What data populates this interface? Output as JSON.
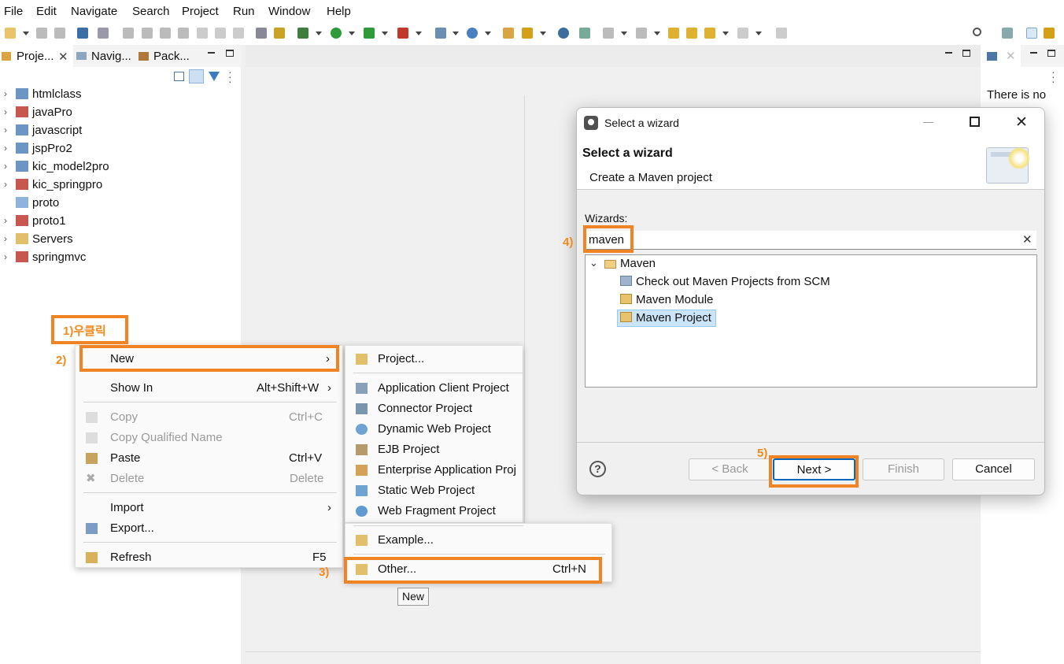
{
  "menubar": [
    "File",
    "Edit",
    "Navigate",
    "Search",
    "Project",
    "Run",
    "Window",
    "Help"
  ],
  "left_tabs": {
    "project": "Proje...",
    "navigator": "Navig...",
    "package": "Pack..."
  },
  "tree": [
    "htmlclass",
    "javaPro",
    "javascript",
    "jspPro2",
    "kic_model2pro",
    "kic_springpro",
    "proto",
    "proto1",
    "Servers",
    "springmvc"
  ],
  "annotations": {
    "a1": "1)우클릭",
    "a2": "2)",
    "a3": "3)",
    "a4": "4)",
    "a5": "5)"
  },
  "context_menu": {
    "new": "New",
    "show_in": "Show In",
    "show_in_key": "Alt+Shift+W",
    "copy": "Copy",
    "copy_key": "Ctrl+C",
    "copy_qualified": "Copy Qualified Name",
    "paste": "Paste",
    "paste_key": "Ctrl+V",
    "delete": "Delete",
    "delete_key": "Delete",
    "import": "Import",
    "export": "Export...",
    "refresh": "Refresh",
    "refresh_key": "F5"
  },
  "submenu": {
    "project": "Project...",
    "app_client": "Application Client Project",
    "connector": "Connector Project",
    "dynamic_web": "Dynamic Web Project",
    "ejb": "EJB Project",
    "enterprise": "Enterprise Application Proj",
    "static_web": "Static Web Project",
    "web_fragment": "Web Fragment Project",
    "example": "Example...",
    "other": "Other...",
    "other_key": "Ctrl+N"
  },
  "tooltip": "New",
  "right_pane_text": "There is no",
  "dialog": {
    "window_title": "Select a wizard",
    "heading": "Select a wizard",
    "subtitle": "Create a Maven project",
    "wizards_label": "Wizards:",
    "filter_value": "maven",
    "tree": {
      "root": "Maven",
      "items": [
        "Check out Maven Projects from SCM",
        "Maven Module",
        "Maven Project"
      ]
    },
    "buttons": {
      "back": "< Back",
      "next": "Next >",
      "finish": "Finish",
      "cancel": "Cancel"
    }
  },
  "colors": {
    "annotation": "#f08323",
    "selection": "#cce4f7"
  }
}
